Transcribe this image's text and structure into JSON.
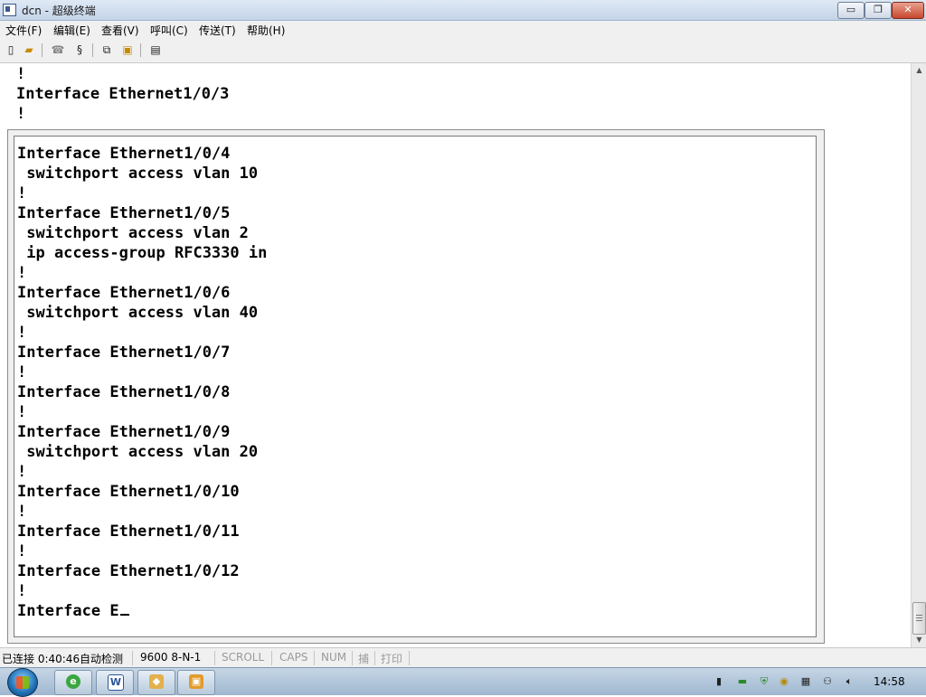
{
  "window": {
    "title": "dcn - 超级终端",
    "min_label": "▭",
    "max_label": "❐",
    "close_label": "✕"
  },
  "menu": [
    "文件(F)",
    "编辑(E)",
    "查看(V)",
    "呼叫(C)",
    "传送(T)",
    "帮助(H)"
  ],
  "toolbar": {
    "icons": [
      "new-file-icon",
      "open-folder-icon",
      "phone-icon",
      "disconnect-icon",
      "send-icon",
      "receive-icon",
      "properties-icon"
    ]
  },
  "terminal": {
    "background_lines": [
      "!",
      "Interface Ethernet1/0/3",
      "!"
    ],
    "lines": [
      "Interface Ethernet1/0/4",
      " switchport access vlan 10",
      "!",
      "Interface Ethernet1/0/5",
      " switchport access vlan 2",
      " ip access-group RFC3330 in",
      "!",
      "Interface Ethernet1/0/6",
      " switchport access vlan 40",
      "!",
      "Interface Ethernet1/0/7",
      "!",
      "Interface Ethernet1/0/8",
      "!",
      "Interface Ethernet1/0/9",
      " switchport access vlan 20",
      "!",
      "Interface Ethernet1/0/10",
      "!",
      "Interface Ethernet1/0/11",
      "!",
      "Interface Ethernet1/0/12",
      "!",
      "Interface E"
    ]
  },
  "status": {
    "connection": "已连接 0:40:46",
    "detect": "自动检测",
    "settings": "9600 8-N-1",
    "scroll": "SCROLL",
    "caps": "CAPS",
    "num": "NUM",
    "capture": "捕",
    "print": "打印"
  },
  "taskbar": {
    "apps": [
      "ie-icon",
      "word-icon",
      "hyperterminal-icon",
      "app-icon"
    ],
    "tray": [
      "media-icon",
      "battery-icon",
      "shield-icon",
      "network-icon",
      "device-icon",
      "usb-icon",
      "volume-icon"
    ],
    "clock": "14:58"
  },
  "colors": {
    "accent": "#1f6fb3",
    "close": "#c8472f"
  }
}
